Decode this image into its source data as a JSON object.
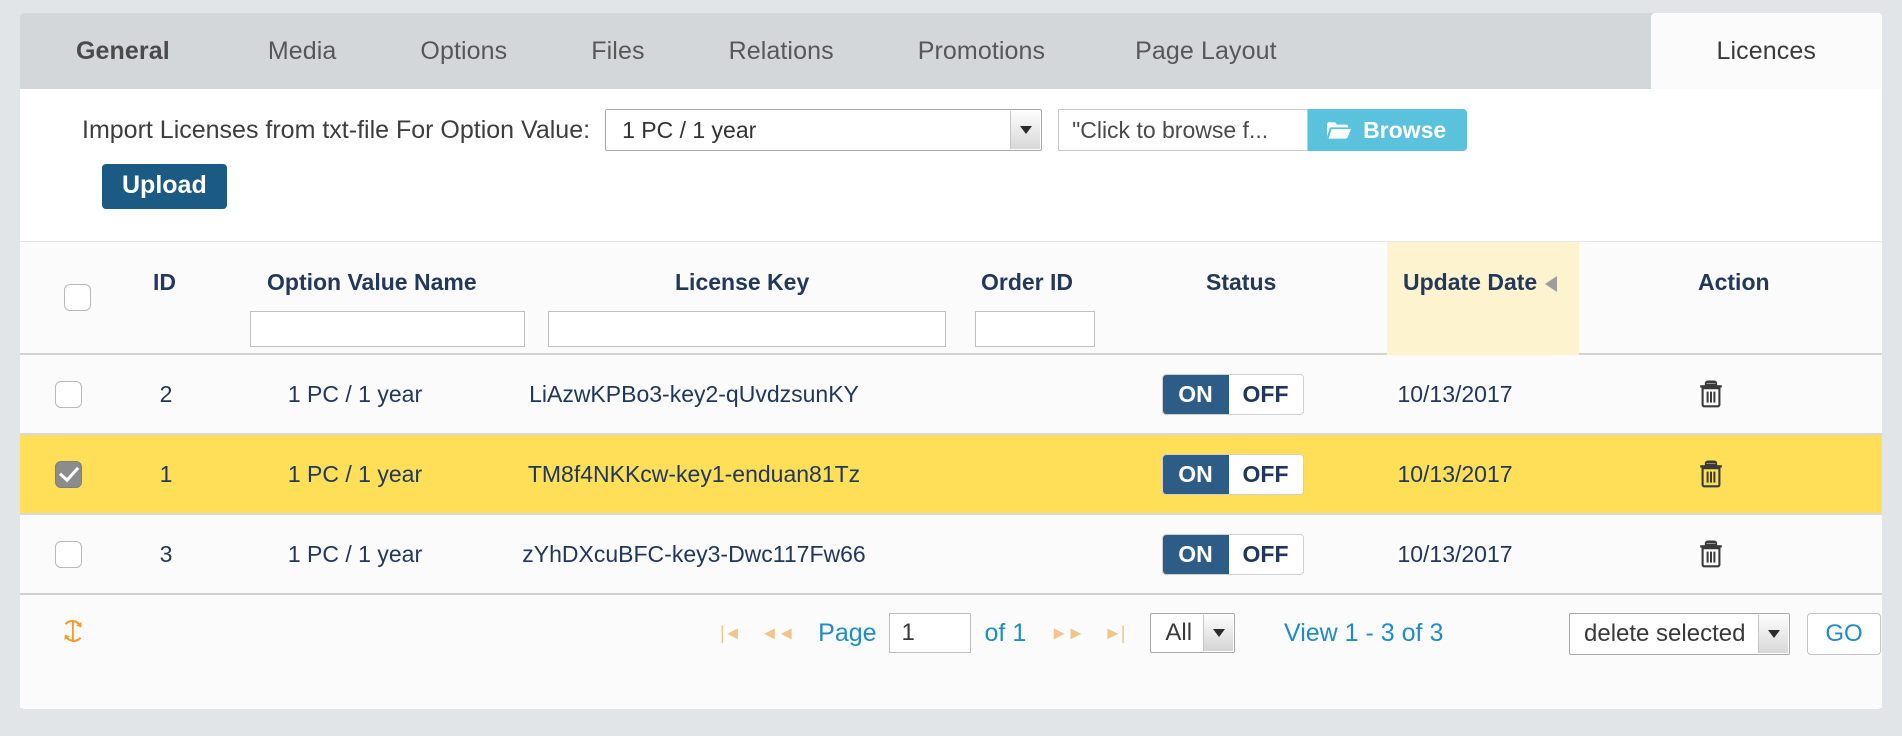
{
  "tabs": [
    {
      "label": "General",
      "active": false,
      "bold": true
    },
    {
      "label": "Media",
      "active": false
    },
    {
      "label": "Options",
      "active": false
    },
    {
      "label": "Files",
      "active": false
    },
    {
      "label": "Relations",
      "active": false
    },
    {
      "label": "Promotions",
      "active": false
    },
    {
      "label": "Page Layout",
      "active": false
    },
    {
      "label": "Licences",
      "active": true
    }
  ],
  "import": {
    "label": "Import Licenses from txt-file For Option Value:",
    "option_value_selected": "1 PC / 1 year",
    "file_field_value": "\"Click to browse f...",
    "browse_label": "Browse",
    "browse_icon": "folder-icon",
    "upload_label": "Upload"
  },
  "table": {
    "columns": [
      {
        "key": "checkbox",
        "label": ""
      },
      {
        "key": "id",
        "label": "ID"
      },
      {
        "key": "name",
        "label": "Option Value Name",
        "filter": true
      },
      {
        "key": "license_key",
        "label": "License Key",
        "filter": true
      },
      {
        "key": "order_id",
        "label": "Order ID",
        "filter": true
      },
      {
        "key": "status",
        "label": "Status"
      },
      {
        "key": "update_date",
        "label": "Update Date",
        "sorted": true,
        "sort_icon": "sort-arrow-icon"
      },
      {
        "key": "action",
        "label": "Action"
      }
    ],
    "filters": {
      "name": "",
      "license_key": "",
      "order_id": ""
    },
    "header_select_all_checked": false,
    "rows": [
      {
        "checked": false,
        "id": "2",
        "name": "1 PC / 1 year",
        "license_key": "LiAzwKPBo3-key2-qUvdzsunKY",
        "order_id": "",
        "status_on": "ON",
        "status_off": "OFF",
        "status_value": "ON",
        "update_date": "10/13/2017",
        "action_icon": "trash-icon",
        "selected": false
      },
      {
        "checked": true,
        "id": "1",
        "name": "1 PC / 1 year",
        "license_key": "TM8f4NKKcw-key1-enduan81Tz",
        "order_id": "",
        "status_on": "ON",
        "status_off": "OFF",
        "status_value": "ON",
        "update_date": "10/13/2017",
        "action_icon": "trash-icon",
        "selected": true
      },
      {
        "checked": false,
        "id": "3",
        "name": "1 PC / 1 year",
        "license_key": "zYhDXcuBFC-key3-Dwc117Fw66",
        "order_id": "",
        "status_on": "ON",
        "status_off": "OFF",
        "status_value": "ON",
        "update_date": "10/13/2017",
        "action_icon": "trash-icon",
        "selected": false
      }
    ]
  },
  "footer": {
    "refresh_icon": "refresh-icon",
    "first_page_icon": "first-page-icon",
    "prev_page_icon": "prev-page-icon",
    "next_page_icon": "next-page-icon",
    "last_page_icon": "last-page-icon",
    "page_word": "Page",
    "page_number": "1",
    "of_text": "of 1",
    "page_size_selected": "All",
    "view_info": "View 1 - 3 of 3",
    "bulk_action_selected": "delete selected",
    "go_label": "GO"
  },
  "colors": {
    "tabbar_bg": "#d4d7da",
    "active_tab_bg": "#fbfbfb",
    "upload_btn": "#1b5b83",
    "browse_btn": "#5bc2de",
    "selected_row": "#ffdf57",
    "sorted_col": "#fdf3cf",
    "toggle_on": "#2d5d87",
    "link_blue": "#1f8dc4",
    "header_text": "#23395c",
    "refresh_orange": "#f59b2b"
  }
}
